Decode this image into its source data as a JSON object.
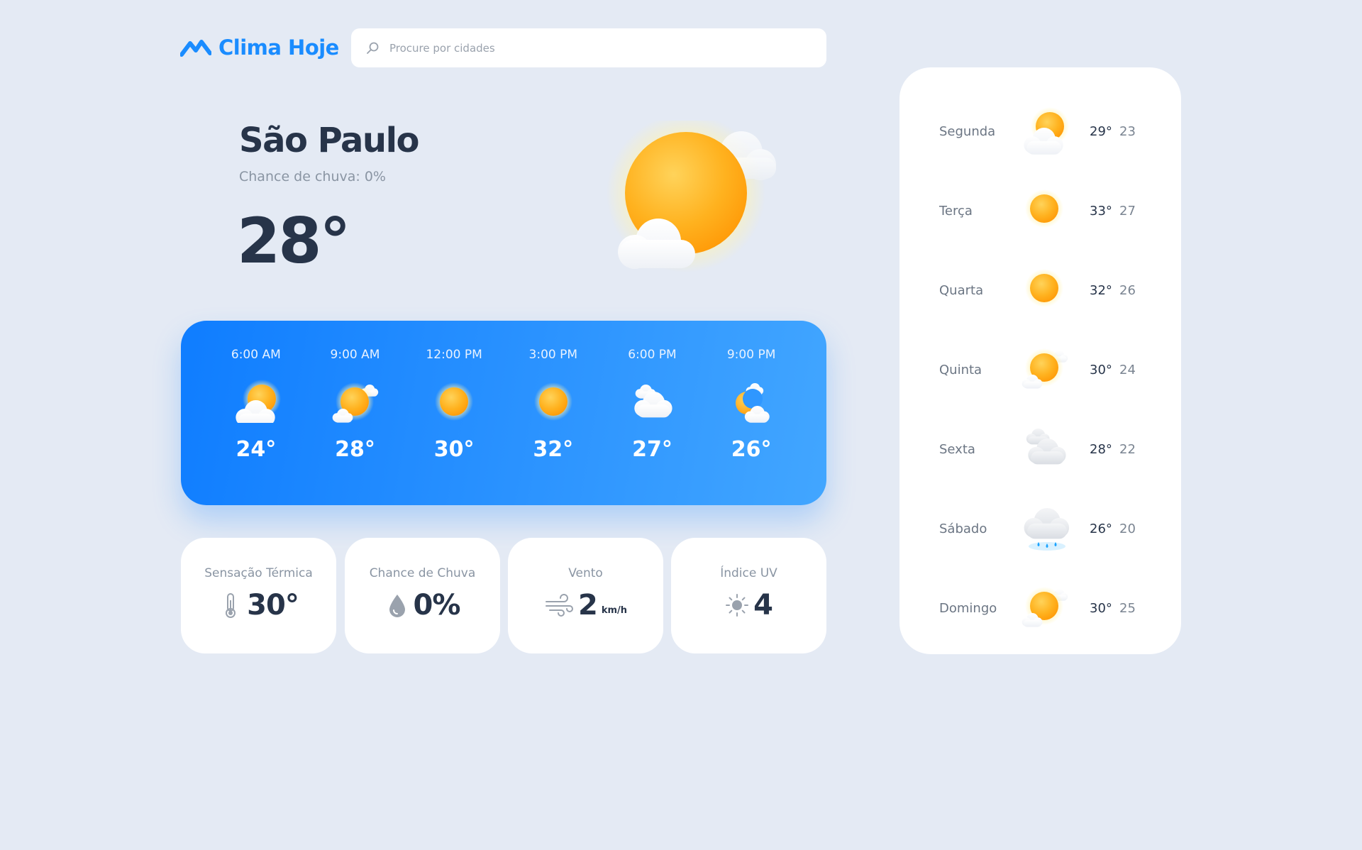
{
  "app": {
    "name": "Clima Hoje",
    "brand_color": "#1a8cff"
  },
  "search": {
    "placeholder": "Procure por cidades",
    "value": ""
  },
  "current": {
    "city": "São Paulo",
    "rain_chance": "Chance de chuva: 0%",
    "temperature": "28°",
    "icon": "sun-with-clouds"
  },
  "hourly": [
    {
      "time": "6:00 AM",
      "temp": "24°",
      "icon": "partly-cloudy"
    },
    {
      "time": "9:00 AM",
      "temp": "28°",
      "icon": "sunny-small-clouds"
    },
    {
      "time": "12:00 PM",
      "temp": "30°",
      "icon": "sunny"
    },
    {
      "time": "3:00 PM",
      "temp": "32°",
      "icon": "sunny"
    },
    {
      "time": "6:00 PM",
      "temp": "27°",
      "icon": "cloudy"
    },
    {
      "time": "9:00 PM",
      "temp": "26°",
      "icon": "moon-clouds"
    }
  ],
  "stats": [
    {
      "label": "Sensação Térmica",
      "value": "30°",
      "unit": "",
      "icon": "thermometer-icon"
    },
    {
      "label": "Chance de Chuva",
      "value": "0%",
      "unit": "",
      "icon": "raindrop-icon"
    },
    {
      "label": "Vento",
      "value": "2",
      "unit": "km/h",
      "icon": "wind-icon"
    },
    {
      "label": "Índice UV",
      "value": "4",
      "unit": "",
      "icon": "uv-sun-icon"
    }
  ],
  "weekly": [
    {
      "day": "Segunda",
      "max": "29°",
      "min": "23",
      "icon": "partly-cloudy"
    },
    {
      "day": "Terça",
      "max": "33°",
      "min": "27",
      "icon": "sunny"
    },
    {
      "day": "Quarta",
      "max": "32°",
      "min": "26",
      "icon": "sunny"
    },
    {
      "day": "Quinta",
      "max": "30°",
      "min": "24",
      "icon": "sunny-small-clouds"
    },
    {
      "day": "Sexta",
      "max": "28°",
      "min": "22",
      "icon": "cloudy-grey"
    },
    {
      "day": "Sábado",
      "max": "26°",
      "min": "20",
      "icon": "rain"
    },
    {
      "day": "Domingo",
      "max": "30°",
      "min": "25",
      "icon": "sunny-small-clouds"
    }
  ]
}
